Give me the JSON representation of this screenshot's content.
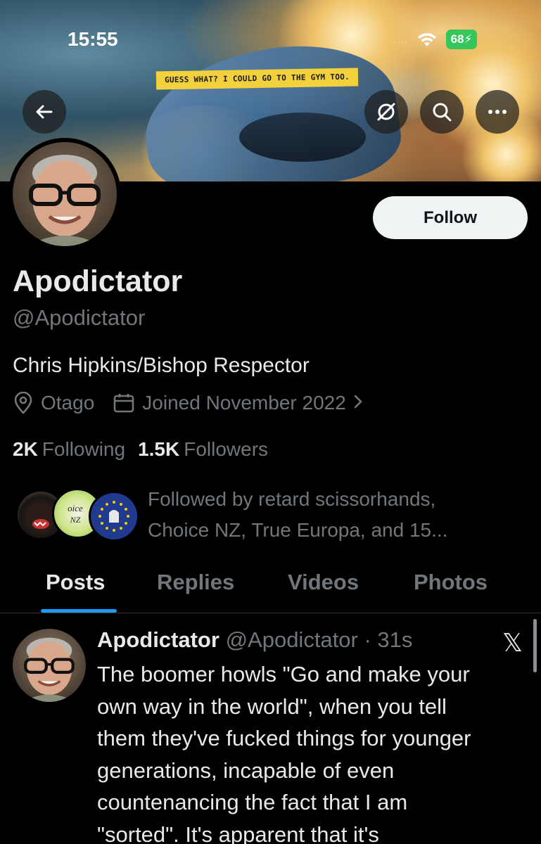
{
  "status_bar": {
    "time": "15:55",
    "signal_dots": "....",
    "battery": "68"
  },
  "banner": {
    "caption": "GUESS WHAT? I COULD GO TO THE GYM TOO."
  },
  "header_buttons": {
    "back": "back-arrow-icon",
    "grok": "grok-icon",
    "search": "search-icon",
    "more": "more-icon"
  },
  "profile": {
    "follow_label": "Follow",
    "display_name": "Apodictator",
    "handle": "@Apodictator",
    "bio": "Chris Hipkins/Bishop Respector",
    "location": "Otago",
    "joined": "Joined November 2022",
    "following_count": "2K",
    "following_label": "Following",
    "followers_count": "1.5K",
    "followers_label": "Followers",
    "followed_by_line1": "Followed by retard scissorhands,",
    "followed_by_line2": "Choice NZ, True Europa, and 15..."
  },
  "tabs": [
    {
      "label": "Posts"
    },
    {
      "label": "Replies"
    },
    {
      "label": "Videos"
    },
    {
      "label": "Photos"
    }
  ],
  "post": {
    "name": "Apodictator",
    "handle": "@Apodictator",
    "separator": " · ",
    "time": "31s",
    "lines": [
      "The boomer howls \"Go and make your",
      "own way in the world\", when you tell",
      "them they've fucked things for younger",
      "generations, incapable of even",
      "countenancing the fact that I am",
      "\"sorted\". It's apparent that it's"
    ]
  },
  "colors": {
    "accent": "#1d9bf0",
    "muted": "#71767b",
    "text": "#e7e9ea",
    "battery": "#35c759"
  }
}
